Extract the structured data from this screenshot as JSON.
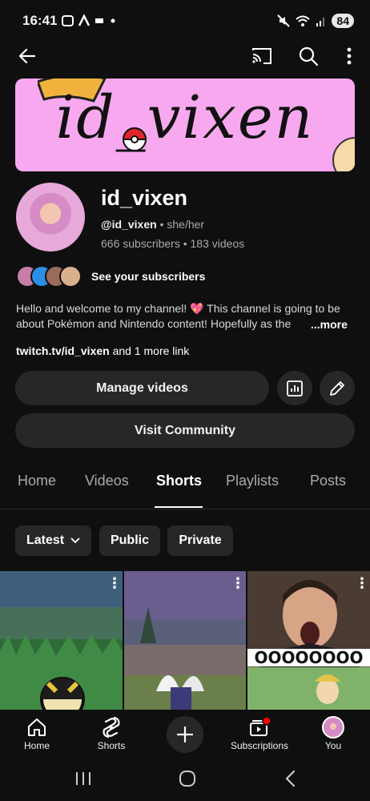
{
  "status_bar": {
    "time": "16:41",
    "battery": "84"
  },
  "topbar": {
    "icons": [
      "back-arrow-icon",
      "cast-icon",
      "search-icon",
      "more-vert-icon"
    ]
  },
  "banner": {
    "text": "id_vixen"
  },
  "channel": {
    "name": "id_vixen",
    "handle": "@id_vixen",
    "pronouns": "she/her",
    "subscribers": "666 subscribers",
    "videos": "183 videos",
    "see_subscribers": "See your subscribers",
    "description": "Hello and welcome to my channel! 💖 This channel is going to be about Pokémon and Nintendo content! Hopefully as the",
    "more_label": "...more",
    "link": "twitch.tv/id_vixen",
    "more_links": "and 1 more link"
  },
  "buttons": {
    "manage_videos": "Manage videos",
    "visit_community": "Visit Community"
  },
  "tabs": [
    {
      "label": "Home"
    },
    {
      "label": "Videos"
    },
    {
      "label": "Shorts",
      "active": true
    },
    {
      "label": "Playlists"
    },
    {
      "label": "Posts"
    }
  ],
  "chips": {
    "latest": "Latest",
    "public": "Public",
    "private": "Private"
  },
  "shorts": {
    "overlay_text": "OOOOOOOO"
  },
  "bottom_nav": {
    "home": "Home",
    "shorts": "Shorts",
    "subscriptions": "Subscriptions",
    "you": "You"
  },
  "colors": {
    "background": "#0f0f0f",
    "surface": "#272727",
    "banner_pink": "#f7a8ef",
    "notification_red": "#ff0000"
  }
}
